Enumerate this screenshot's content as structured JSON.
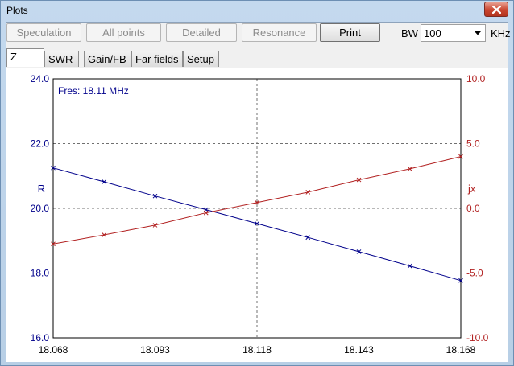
{
  "window": {
    "title": "Plots"
  },
  "toolbar": {
    "buttons": [
      {
        "label": "Speculation",
        "enabled": false
      },
      {
        "label": "All points",
        "enabled": false
      },
      {
        "label": "Detailed",
        "enabled": false
      },
      {
        "label": "Resonance",
        "enabled": false
      },
      {
        "label": "Print",
        "enabled": true
      }
    ],
    "bw_label": "BW",
    "bw_value": "100",
    "unit_label": "KHz"
  },
  "tabs": [
    {
      "label": "Z",
      "active": true
    },
    {
      "label": "SWR",
      "active": false
    },
    {
      "label": "Gain/FB",
      "active": false
    },
    {
      "label": "Far fields",
      "active": false
    },
    {
      "label": "Setup",
      "active": false
    }
  ],
  "chart_data": {
    "type": "line",
    "annotation": "Fres: 18.11 MHz",
    "x": [
      18.068,
      18.0805,
      18.093,
      18.1055,
      18.118,
      18.1305,
      18.143,
      18.1555,
      18.168
    ],
    "x_tick_labels": [
      "18.068",
      "18.093",
      "18.118",
      "18.143",
      "18.168"
    ],
    "xlim": [
      18.068,
      18.168
    ],
    "left_axis": {
      "label": "R",
      "ylim": [
        16,
        24
      ],
      "tick_labels": [
        "16.0",
        "18.0",
        "20.0",
        "22.0",
        "24.0"
      ]
    },
    "right_axis": {
      "label": "jx",
      "ylim": [
        -10,
        10
      ],
      "tick_labels": [
        "-10.0",
        "-5.0",
        "0.0",
        "5.0",
        "10.0"
      ]
    },
    "series": [
      {
        "axis": "left",
        "color": "#00008b",
        "values": [
          21.25,
          20.82,
          20.38,
          19.96,
          19.53,
          19.1,
          18.66,
          18.22,
          17.77
        ]
      },
      {
        "axis": "right",
        "color": "#b22222",
        "values": [
          -2.75,
          -2.05,
          -1.3,
          -0.35,
          0.45,
          1.25,
          2.2,
          3.05,
          4.0
        ]
      }
    ],
    "grid": true,
    "grid_style": "dashed"
  },
  "colors": {
    "left_axis": "#00008b",
    "right_axis": "#b22222"
  }
}
